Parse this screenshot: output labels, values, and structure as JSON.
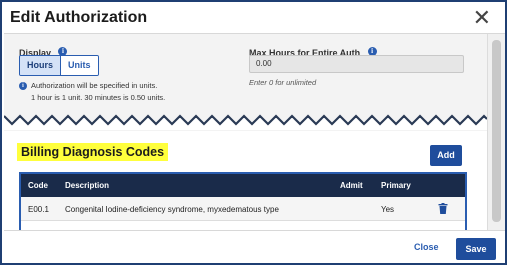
{
  "dialog": {
    "title": "Edit Authorization",
    "close_glyph": "✕"
  },
  "display": {
    "label": "Display",
    "info_glyph": "i",
    "options": [
      "Hours",
      "Units"
    ],
    "selected": "Hours",
    "note_line1": "Authorization will be specified in units.",
    "note_line2": "1 hour is 1 unit. 30 minutes is 0.50 units."
  },
  "max_hours": {
    "label": "Max Hours for Entire Auth",
    "info_glyph": "i",
    "value": "0.00",
    "hint": "Enter 0 for unlimited"
  },
  "billing": {
    "title": "Billing Diagnosis Codes",
    "add_label": "Add",
    "columns": [
      "Code",
      "Description",
      "Admit",
      "Primary"
    ],
    "rows": [
      {
        "code": "E00.1",
        "description": "Congenital Iodine-deficiency syndrome, myxedematous type",
        "admit": "",
        "primary": "Yes"
      }
    ]
  },
  "footer": {
    "close_label": "Close",
    "save_label": "Save"
  },
  "colors": {
    "accent": "#1f4d9c",
    "highlight": "#ffff3c",
    "table_header": "#1a2b4a",
    "frame_border": "#1f3f73"
  },
  "icons": {
    "close": "close-icon",
    "info": "info-icon",
    "delete": "trash-icon"
  }
}
